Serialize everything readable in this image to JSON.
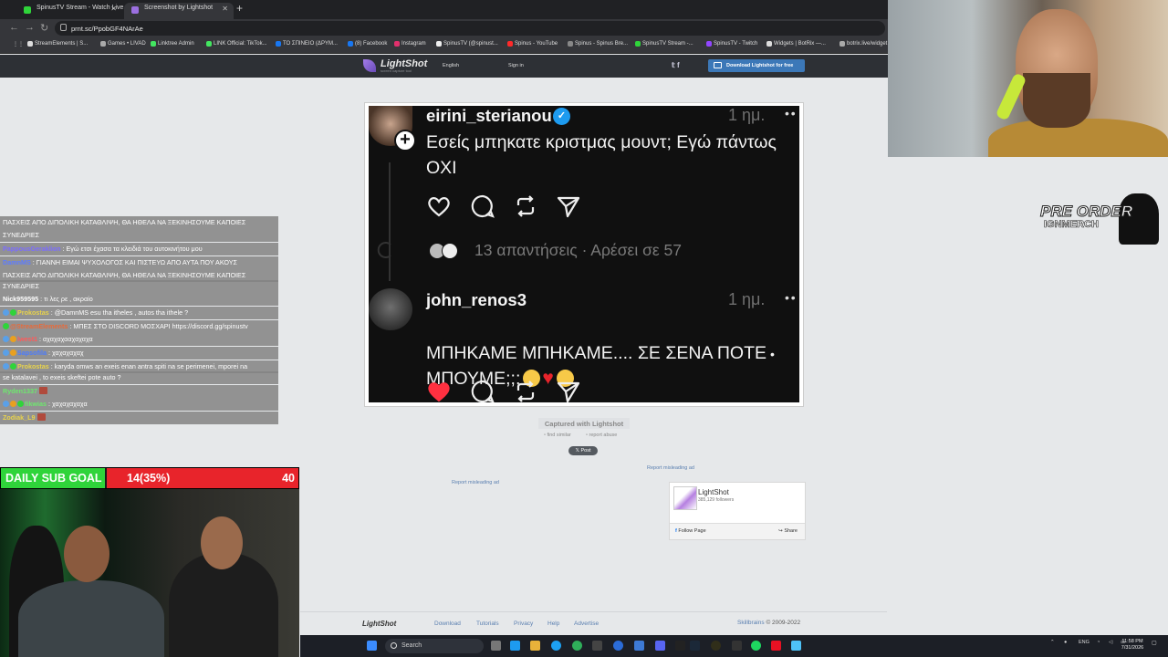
{
  "browser": {
    "tabs": [
      {
        "title": "SpinusTV Stream - Watch Live",
        "active": false
      },
      {
        "title": "Screenshot by Lightshot",
        "active": true
      }
    ],
    "address": "prnt.sc/PpobGF4NArAe",
    "bookmarks": [
      "StreamElements | S...",
      "Games • LIVAD",
      "Linktree Admin",
      "LINK Official: TikTok...",
      "ΤΟ ΣΠΙΝΕΙΟ (ΔΡΥΜ...",
      "(8) Facebook",
      "Instagram",
      "SpinusTV (@spinust...",
      "Spinus - YouTube",
      "Spinus - Spinus Bre...",
      "SpinusTV Stream -...",
      "SpinusTV - Twitch",
      "Widgets | BotRix —...",
      "botrix.live/widget"
    ]
  },
  "lightshot": {
    "logo": "LightShot",
    "tagline": "screen capture tool",
    "language": "English",
    "sign_in": "Sign in",
    "download": "Download Lightshot for free",
    "captured": "Captured with Lightshot",
    "find_similar": "find similar",
    "report_abuse": "report abuse",
    "post": "Post",
    "report_ad": "Report misleading ad",
    "fb_card": {
      "title": "LightShot",
      "followers": "385,129 followers",
      "follow": "Follow Page",
      "share": "Share"
    },
    "footer": {
      "logo": "LightShot",
      "links": [
        "Download",
        "Tutorials",
        "Privacy",
        "Help",
        "Advertise"
      ],
      "copyright_link": "Skillbrains",
      "copyright": "© 2009-2022"
    }
  },
  "threads": {
    "post1": {
      "user": "eirini_sterianou",
      "time": "1 ημ.",
      "text": "Εσείς μπηκατε κριστμας μουντ; Εγώ πάντως\nΟΧΙ",
      "stats": "13 απαντήσεις · Αρέσει σε 57"
    },
    "post2": {
      "user": "john_renos3",
      "time": "1 ημ.",
      "text_line1": "ΜΠΗΚΑΜΕ ΜΠΗΚΑΜΕ.... ΣΕ ΣΕΝΑ ΠΟΤΕ",
      "text_line2": "ΜΠΟΥΜΕ;;;"
    }
  },
  "stream": {
    "preorder_line1": "PRE ORDER",
    "preorder_line2": "IGNMERCH",
    "chat": [
      {
        "user": "",
        "msg": "ΠΑΣΧΕΙΣ ΑΠΟ ΔΙΠΟΛΙΚΗ ΚΑΤΑΘΛΙΨΗ, ΘΑ ΗΘΕΛΑ ΝΑ ΞΕΚΙΝΗΣΟΥΜΕ ΚΑΠΟΙΕΣ"
      },
      {
        "user": "",
        "msg": "ΣΥΝΕΔΡΙΕΣ"
      },
      {
        "user": "PappousGeraklion",
        "msg": ": Εγώ ετσι έχασα τα κλειδιά του αυτοκινήτου μου"
      },
      {
        "user": "DamnMS",
        "msg": ": ΓΙΑΝΝΗ ΕΙΜΑΙ ΨΥΧΟΛΟΓΟΣ ΚΑΙ ΠΙΣΤΕΥΩ ΑΠΟ ΑΥΤΑ ΠΟΥ ΑΚΟΥΣ"
      },
      {
        "user": "",
        "msg": "ΠΑΣΧΕΙΣ ΑΠΟ ΔΙΠΟΛΙΚΗ ΚΑΤΑΘΛΙΨΗ, ΘΑ ΗΘΕΛΑ ΝΑ ΞΕΚΙΝΗΣΟΥΜΕ ΚΑΠΟΙΕΣ"
      },
      {
        "user": "",
        "msg": "ΣΥΝΕΔΡΙΕΣ"
      },
      {
        "user": "Nick959595",
        "msg": ": τι λες ρε , ακραίο"
      },
      {
        "user": "Prokostas",
        "msg": ": @DamnMS esu tha itheles , autos tha ithele ?"
      },
      {
        "user": "@StreamElements",
        "msg": ": ΜΠΕΣ ΣΤΟ DISCORD ΜΟΣΧΑΡΙ https://discord.gg/spinustv"
      },
      {
        "user": "lwest1",
        "msg": ": αχαχαχααχαχαχα"
      },
      {
        "user": "Sapsofila",
        "msg": ": χαχαχαχαχ"
      },
      {
        "user": "Prokostas",
        "msg": ": karyda omws an exeis enan antra spiti na se perimenei, mporei na"
      },
      {
        "user": "",
        "msg": "se katalavei , to exeis skeftei pote auto ?"
      },
      {
        "user": "Ryden1337",
        "msg": ":"
      },
      {
        "user": "fikwias",
        "msg": ": χαχαχαχαχα"
      },
      {
        "user": "Zodiak_L9",
        "msg": ":"
      }
    ],
    "sub_goal": {
      "label": "DAILY SUB GOAL",
      "current": "14(35%)",
      "target": "40",
      "progress": 0.35
    }
  },
  "taskbar": {
    "search": "Search",
    "lang": "ENG",
    "time": "11:58 PM",
    "date": "7/31/2026"
  }
}
